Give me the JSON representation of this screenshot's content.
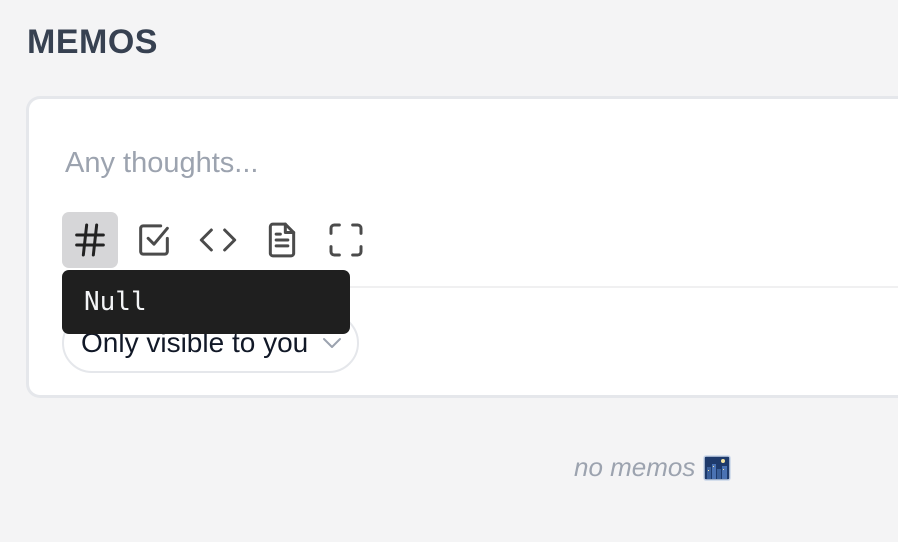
{
  "header": {
    "title": "MEMOS"
  },
  "editor": {
    "placeholder": "Any thoughts...",
    "toolbar": [
      {
        "icon": "hash-icon",
        "active": true
      },
      {
        "icon": "checkbox-icon",
        "active": false
      },
      {
        "icon": "code-icon",
        "active": false
      },
      {
        "icon": "document-icon",
        "active": false
      },
      {
        "icon": "fullscreen-icon",
        "active": false
      }
    ],
    "tooltip_text": "Null",
    "visibility": {
      "selected": "Only visible to you"
    }
  },
  "empty_state": {
    "text": "no memos",
    "icon": "night-city-icon"
  },
  "colors": {
    "background": "#f4f4f5",
    "card": "#ffffff",
    "title": "#374151",
    "placeholder": "#9ca3af",
    "tooltip_bg": "#1f1f1f"
  }
}
